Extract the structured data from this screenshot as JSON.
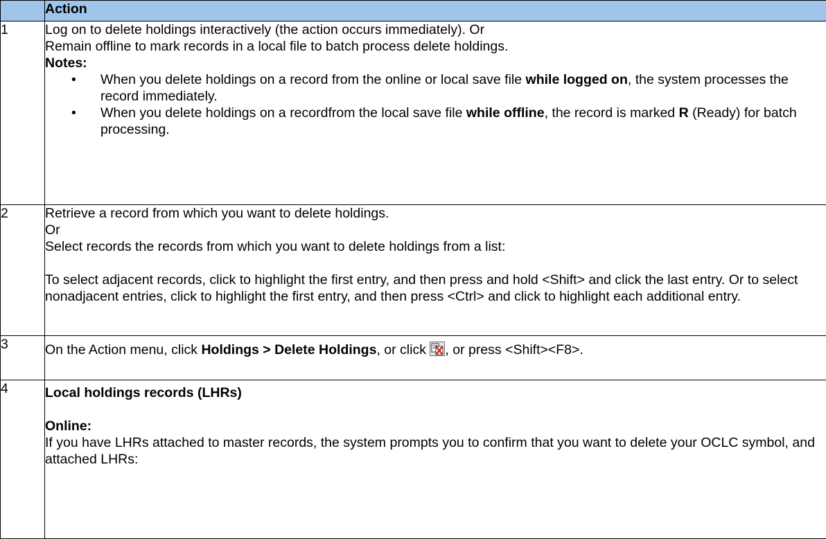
{
  "header": {
    "number_col": "",
    "action_col": "Action"
  },
  "steps": [
    {
      "num": "1",
      "line1": "Log on to delete holdings interactively (the action occurs immediately). Or",
      "line2": "Remain offline to mark records in a local file to batch process delete holdings.",
      "notes_label": "Notes:",
      "note1_a": "When you delete holdings on a record from the online or local save file ",
      "note1_b": "while logged on",
      "note1_c": ", the system processes the record immediately.",
      "note2_a": "When you delete holdings on a recordfrom the local save file ",
      "note2_b": "while offline",
      "note2_c": ", the record is marked ",
      "note2_d": "R",
      "note2_e": " (Ready) for batch processing."
    },
    {
      "num": "2",
      "line1": "Retrieve a record from which you want to delete holdings.",
      "line2": "Or",
      "line3": "Select records the records from which you want to delete holdings from a list:",
      "line4": "To select adjacent records, click to highlight the first entry, and then press and hold <Shift> and click the last entry. Or to select nonadjacent entries, click to highlight the first entry, and then press <Ctrl> and click to highlight each additional entry."
    },
    {
      "num": "3",
      "text_a": "On the Action menu, click ",
      "text_b": "Holdings > Delete Holdings",
      "text_c": ", or click ",
      "icon": "delete-holdings-icon",
      "text_d": ", or press <Shift><F8>."
    },
    {
      "num": "4",
      "heading": "Local holdings records (LHRs)",
      "subheading": "Online:",
      "text": "If you have LHRs attached to master records, the system prompts you to confirm that you want to delete your OCLC symbol, and attached LHRs:"
    }
  ]
}
